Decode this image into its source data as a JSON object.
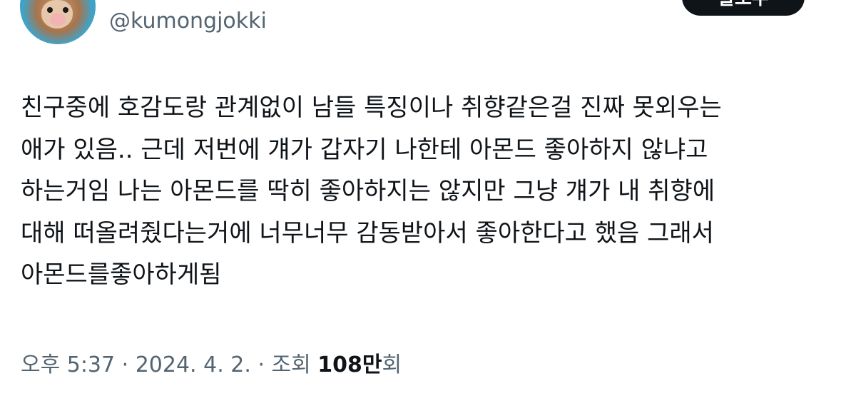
{
  "profile": {
    "handle": "@kumongjokki",
    "follow_label": "팔로우"
  },
  "tweet": {
    "lines": [
      "친구중에 호감도랑 관계없이 남들 특징이나 취향같은걸 진짜 못외우는",
      "애가 있음.. 근데 저번에 걔가 갑자기 나한테 아몬드 좋아하지 않냐고",
      "하는거임 나는 아몬드를 딱히 좋아하지는 않지만 그냥 걔가 내 취향에",
      "대해 떠올려줬다는거에 너무너무 감동받아서 좋아한다고 했음 그래서",
      "아몬드를좋아하게됨"
    ]
  },
  "meta": {
    "timestamp": "오후 5:37 · 2024. 4. 2. · 조회 ",
    "views_count": "108만",
    "views_suffix": "회"
  }
}
